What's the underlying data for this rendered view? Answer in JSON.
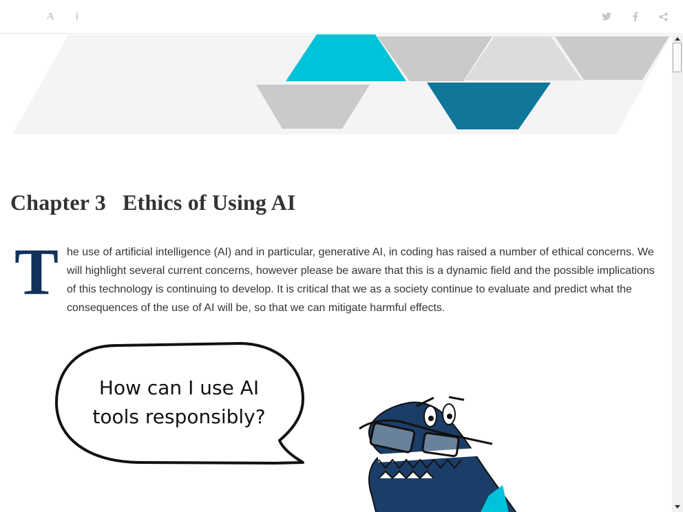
{
  "toolbar": {
    "icons": [
      "font-icon",
      "info-icon",
      "twitter-icon",
      "facebook-icon",
      "share-icon"
    ],
    "font_glyph": "A",
    "info_glyph": "i",
    "icon_color": "#c7c7c7"
  },
  "chapter": {
    "number": "Chapter 3",
    "title": "Ethics of Using AI"
  },
  "intro": {
    "dropcap": "T",
    "text": "he use of artificial intelligence (AI) and in particular, generative AI, in coding has raised a number of ethical concerns. We will highlight several current concerns, however please be aware that this is a dynamic field and the possible implications of this technology is continuing to develop. It is critical that we as a society continue to evaluate and predict what the consequences of the use of AI will be, so that we can mitigate harmful effects."
  },
  "comic": {
    "speech_line1": "How can I use AI",
    "speech_line2": "tools responsibly?"
  },
  "colors": {
    "dropcap": "#13325b",
    "banner_cyan": "#00c2d9",
    "banner_teal": "#10769a",
    "banner_grey": "#cacaca",
    "dino": "#1b3e68"
  }
}
